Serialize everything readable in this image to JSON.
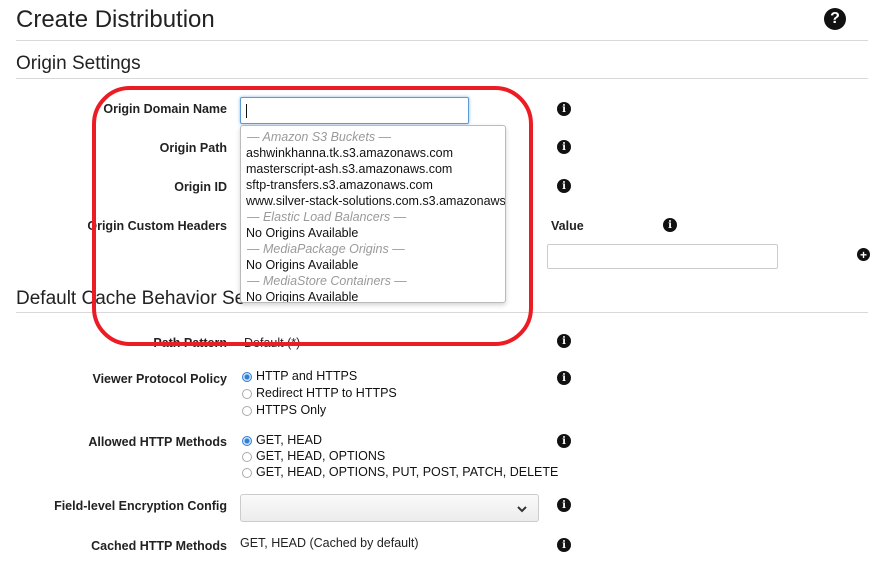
{
  "header": {
    "title": "Create Distribution"
  },
  "origin_settings": {
    "title": "Origin Settings",
    "domain_name_label": "Origin Domain Name",
    "domain_name_value": "",
    "path_label": "Origin Path",
    "id_label": "Origin ID",
    "custom_headers_label": "Origin Custom Headers",
    "value_label": "Value"
  },
  "dropdown": {
    "items": [
      {
        "kind": "group",
        "text": "— Amazon S3 Buckets —"
      },
      {
        "kind": "option",
        "text": "ashwinkhanna.tk.s3.amazonaws.com"
      },
      {
        "kind": "option",
        "text": "masterscript-ash.s3.amazonaws.com"
      },
      {
        "kind": "option",
        "text": "sftp-transfers.s3.amazonaws.com"
      },
      {
        "kind": "option",
        "text": "www.silver-stack-solutions.com.s3.amazonaws"
      },
      {
        "kind": "group",
        "text": "— Elastic Load Balancers —"
      },
      {
        "kind": "option",
        "text": "No Origins Available"
      },
      {
        "kind": "group",
        "text": "— MediaPackage Origins —"
      },
      {
        "kind": "option",
        "text": "No Origins Available"
      },
      {
        "kind": "group",
        "text": "— MediaStore Containers —"
      },
      {
        "kind": "option",
        "text": "No Origins Available"
      }
    ]
  },
  "cache_behavior": {
    "title": "Default Cache Behavior Se",
    "path_pattern_label": "Path Pattern",
    "path_pattern_value": "Default (*)",
    "viewer_protocol_label": "Viewer Protocol Policy",
    "viewer_protocol_options": [
      "HTTP and HTTPS",
      "Redirect HTTP to HTTPS",
      "HTTPS Only"
    ],
    "viewer_protocol_selected": "HTTP and HTTPS",
    "allowed_methods_label": "Allowed HTTP Methods",
    "allowed_methods_options": [
      "GET, HEAD",
      "GET, HEAD, OPTIONS",
      "GET, HEAD, OPTIONS, PUT, POST, PATCH, DELETE"
    ],
    "allowed_methods_selected": "GET, HEAD",
    "fle_label": "Field-level Encryption Config",
    "fle_value": "",
    "cached_methods_label": "Cached HTTP Methods",
    "cached_methods_value": "GET, HEAD (Cached by default)"
  },
  "icons": {
    "help": "question-circle-icon",
    "info": "info-circle-icon",
    "add": "plus-circle-icon",
    "select": "chevron-down-icon"
  },
  "colors": {
    "highlight": "#ec1c24",
    "focus": "#5b9bd5",
    "radio_selected": "#2f7fd6"
  }
}
